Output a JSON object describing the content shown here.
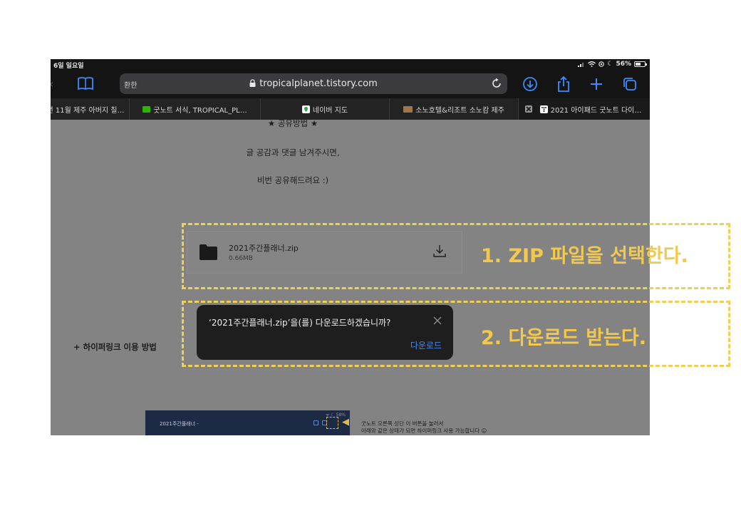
{
  "status_bar": {
    "time": "6일 일요일",
    "battery": "56%",
    "battery_level": 0.56
  },
  "toolbar": {
    "reader_label": "환한",
    "url": "tropicalplanet.tistory.com"
  },
  "tabs": [
    {
      "label": "년 11월 제주 아버지 칠…"
    },
    {
      "label": "굿노트 서식, TROPICAL_PL…",
      "favicon_color": "#2db400"
    },
    {
      "label": "네이버 지도",
      "favicon_color": "#34a853"
    },
    {
      "label": "소노호텔&리조트 소노캄 제주",
      "favicon_color": "#a0764e"
    },
    {
      "label": "2021 아이패드 굿노트 다이…",
      "active": true
    }
  ],
  "content": {
    "heading": "★ 공유방법 ★",
    "line1": "글 공감과 댓글 남겨주시면,",
    "line2": "비번 공유해드려요 :)",
    "hyperlink_label": "+ 하이퍼링크 이용 방법"
  },
  "file": {
    "name": "2021주간플래너.zip",
    "size": "0.66MB"
  },
  "popup": {
    "message": "‘2021주간플래너.zip’을(를) 다운로드하겠습니까?",
    "button": "다운로드"
  },
  "preview": {
    "title": "2021주간플래너 -",
    "status": "ᯤ ☾ 58%",
    "note_line1": "굿노트 오른쪽 상단 이 버튼을 눌러서",
    "note_line2": "아래와 같은 상태가 되면 하이퍼링크 사용 가능합니다 ☺"
  },
  "annotations": {
    "step1": "1. ZIP 파일을 선택한다.",
    "step2": "2. 다운로드 받는다."
  },
  "colors": {
    "accent_blue": "#3d8bff",
    "annotation_yellow": "#f2c94c"
  }
}
